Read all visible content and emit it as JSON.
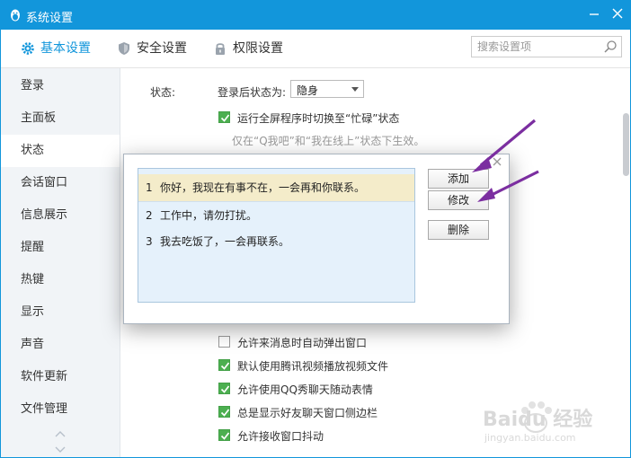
{
  "window": {
    "title": "系统设置"
  },
  "toolbar": {
    "tabs": [
      {
        "label": "基本设置",
        "active": true
      },
      {
        "label": "安全设置",
        "active": false
      },
      {
        "label": "权限设置",
        "active": false
      }
    ],
    "search_placeholder": "搜索设置项"
  },
  "sidebar": {
    "items": [
      {
        "label": "登录"
      },
      {
        "label": "主面板"
      },
      {
        "label": "状态",
        "active": true
      },
      {
        "label": "会话窗口"
      },
      {
        "label": "信息展示"
      },
      {
        "label": "提醒"
      },
      {
        "label": "热键"
      },
      {
        "label": "显示"
      },
      {
        "label": "声音"
      },
      {
        "label": "软件更新"
      },
      {
        "label": "文件管理"
      }
    ]
  },
  "content": {
    "status_label": "状态:",
    "after_login_label": "登录后状态为:",
    "after_login_value": "隐身",
    "fullscreen_busy": "运行全屏程序时切换至“忙碌”状态",
    "fullscreen_hint": "仅在“Q我吧”和“我在线上”状态下生效。",
    "options": [
      {
        "label": "允许来消息时自动弹出窗口",
        "checked": false
      },
      {
        "label": "默认使用腾讯视频播放视频文件",
        "checked": true
      },
      {
        "label": "允许使用QQ秀聊天随动表情",
        "checked": true
      },
      {
        "label": "总是显示好友聊天窗口侧边栏",
        "checked": true
      },
      {
        "label": "允许接收窗口抖动",
        "checked": true
      }
    ]
  },
  "dialog": {
    "close": "×",
    "messages": [
      {
        "num": "1",
        "text": "你好，我现在有事不在，一会再和你联系。"
      },
      {
        "num": "2",
        "text": "工作中，请勿打扰。"
      },
      {
        "num": "3",
        "text": "我去吃饭了，一会再联系。"
      }
    ],
    "buttons": {
      "add": "添加",
      "modify": "修改",
      "delete": "删除"
    }
  },
  "watermark": {
    "text": "Baidu 经验",
    "url": "jingyan.baidu.com"
  },
  "colors": {
    "accent": "#1296db",
    "check": "#4caf50",
    "arrow": "#7b2ea0"
  }
}
